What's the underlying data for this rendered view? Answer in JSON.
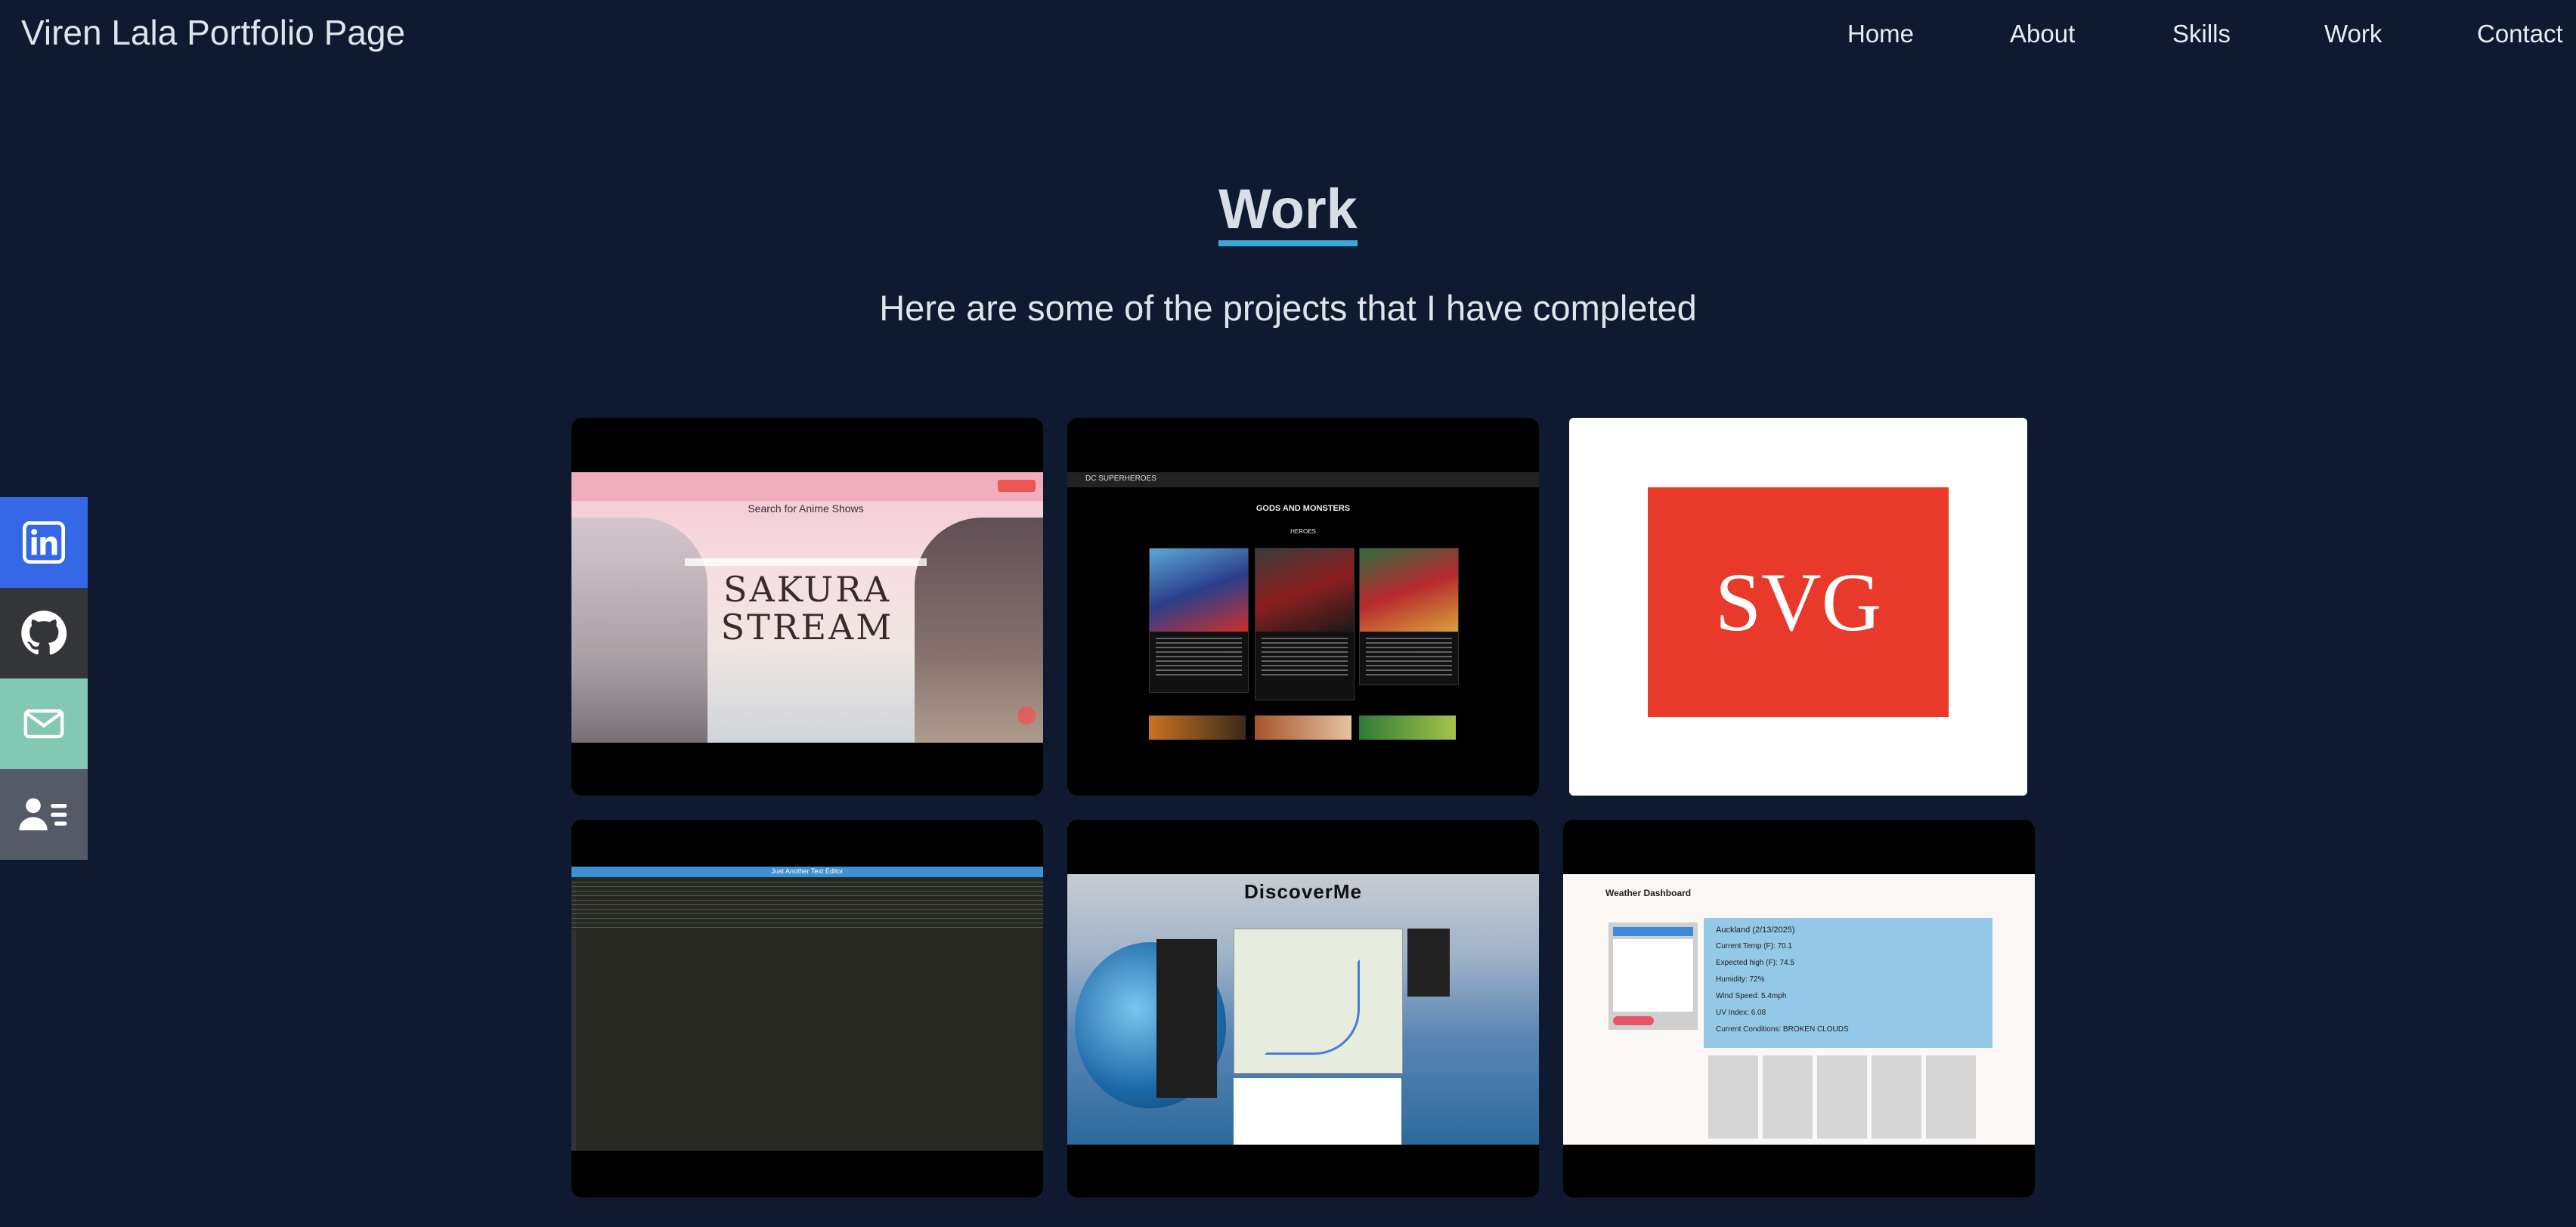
{
  "header": {
    "brand": "Viren Lala Portfolio Page",
    "nav": [
      "Home",
      "About",
      "Skills",
      "Work",
      "Contact"
    ]
  },
  "section": {
    "title": "Work",
    "subtitle": "Here are some of the projects that I have completed"
  },
  "social": {
    "items": [
      "linkedin-icon",
      "github-icon",
      "mail-icon",
      "resume-icon"
    ],
    "colors": [
      "#3568e6",
      "#333539",
      "#83c8b3",
      "#545b66"
    ]
  },
  "projects": [
    {
      "screenshot": {
        "logo_line1": "SAKURA",
        "logo_line2": "STREAM",
        "search_heading": "Search for Anime Shows"
      }
    },
    {
      "screenshot": {
        "brand": "DC SUPERHEROES",
        "heading": "GODS AND MONSTERS",
        "subheading": "HEROES"
      }
    },
    {
      "screenshot": {
        "label": "SVG"
      }
    },
    {
      "screenshot": {
        "title": "Just Another Text Editor"
      }
    },
    {
      "screenshot": {
        "title": "DiscoverMe"
      }
    },
    {
      "screenshot": {
        "title": "Weather Dashboard",
        "city": "Auckland (2/13/2025)",
        "temp": "Current Temp (F): 70.1",
        "high": "Expected high (F): 74.5",
        "humidity": "Humidity: 72%",
        "wind": "Wind Speed: 5.4mph",
        "uv": "UV Index: 6.08",
        "conditions": "Current Conditions: BROKEN CLOUDS"
      }
    }
  ]
}
